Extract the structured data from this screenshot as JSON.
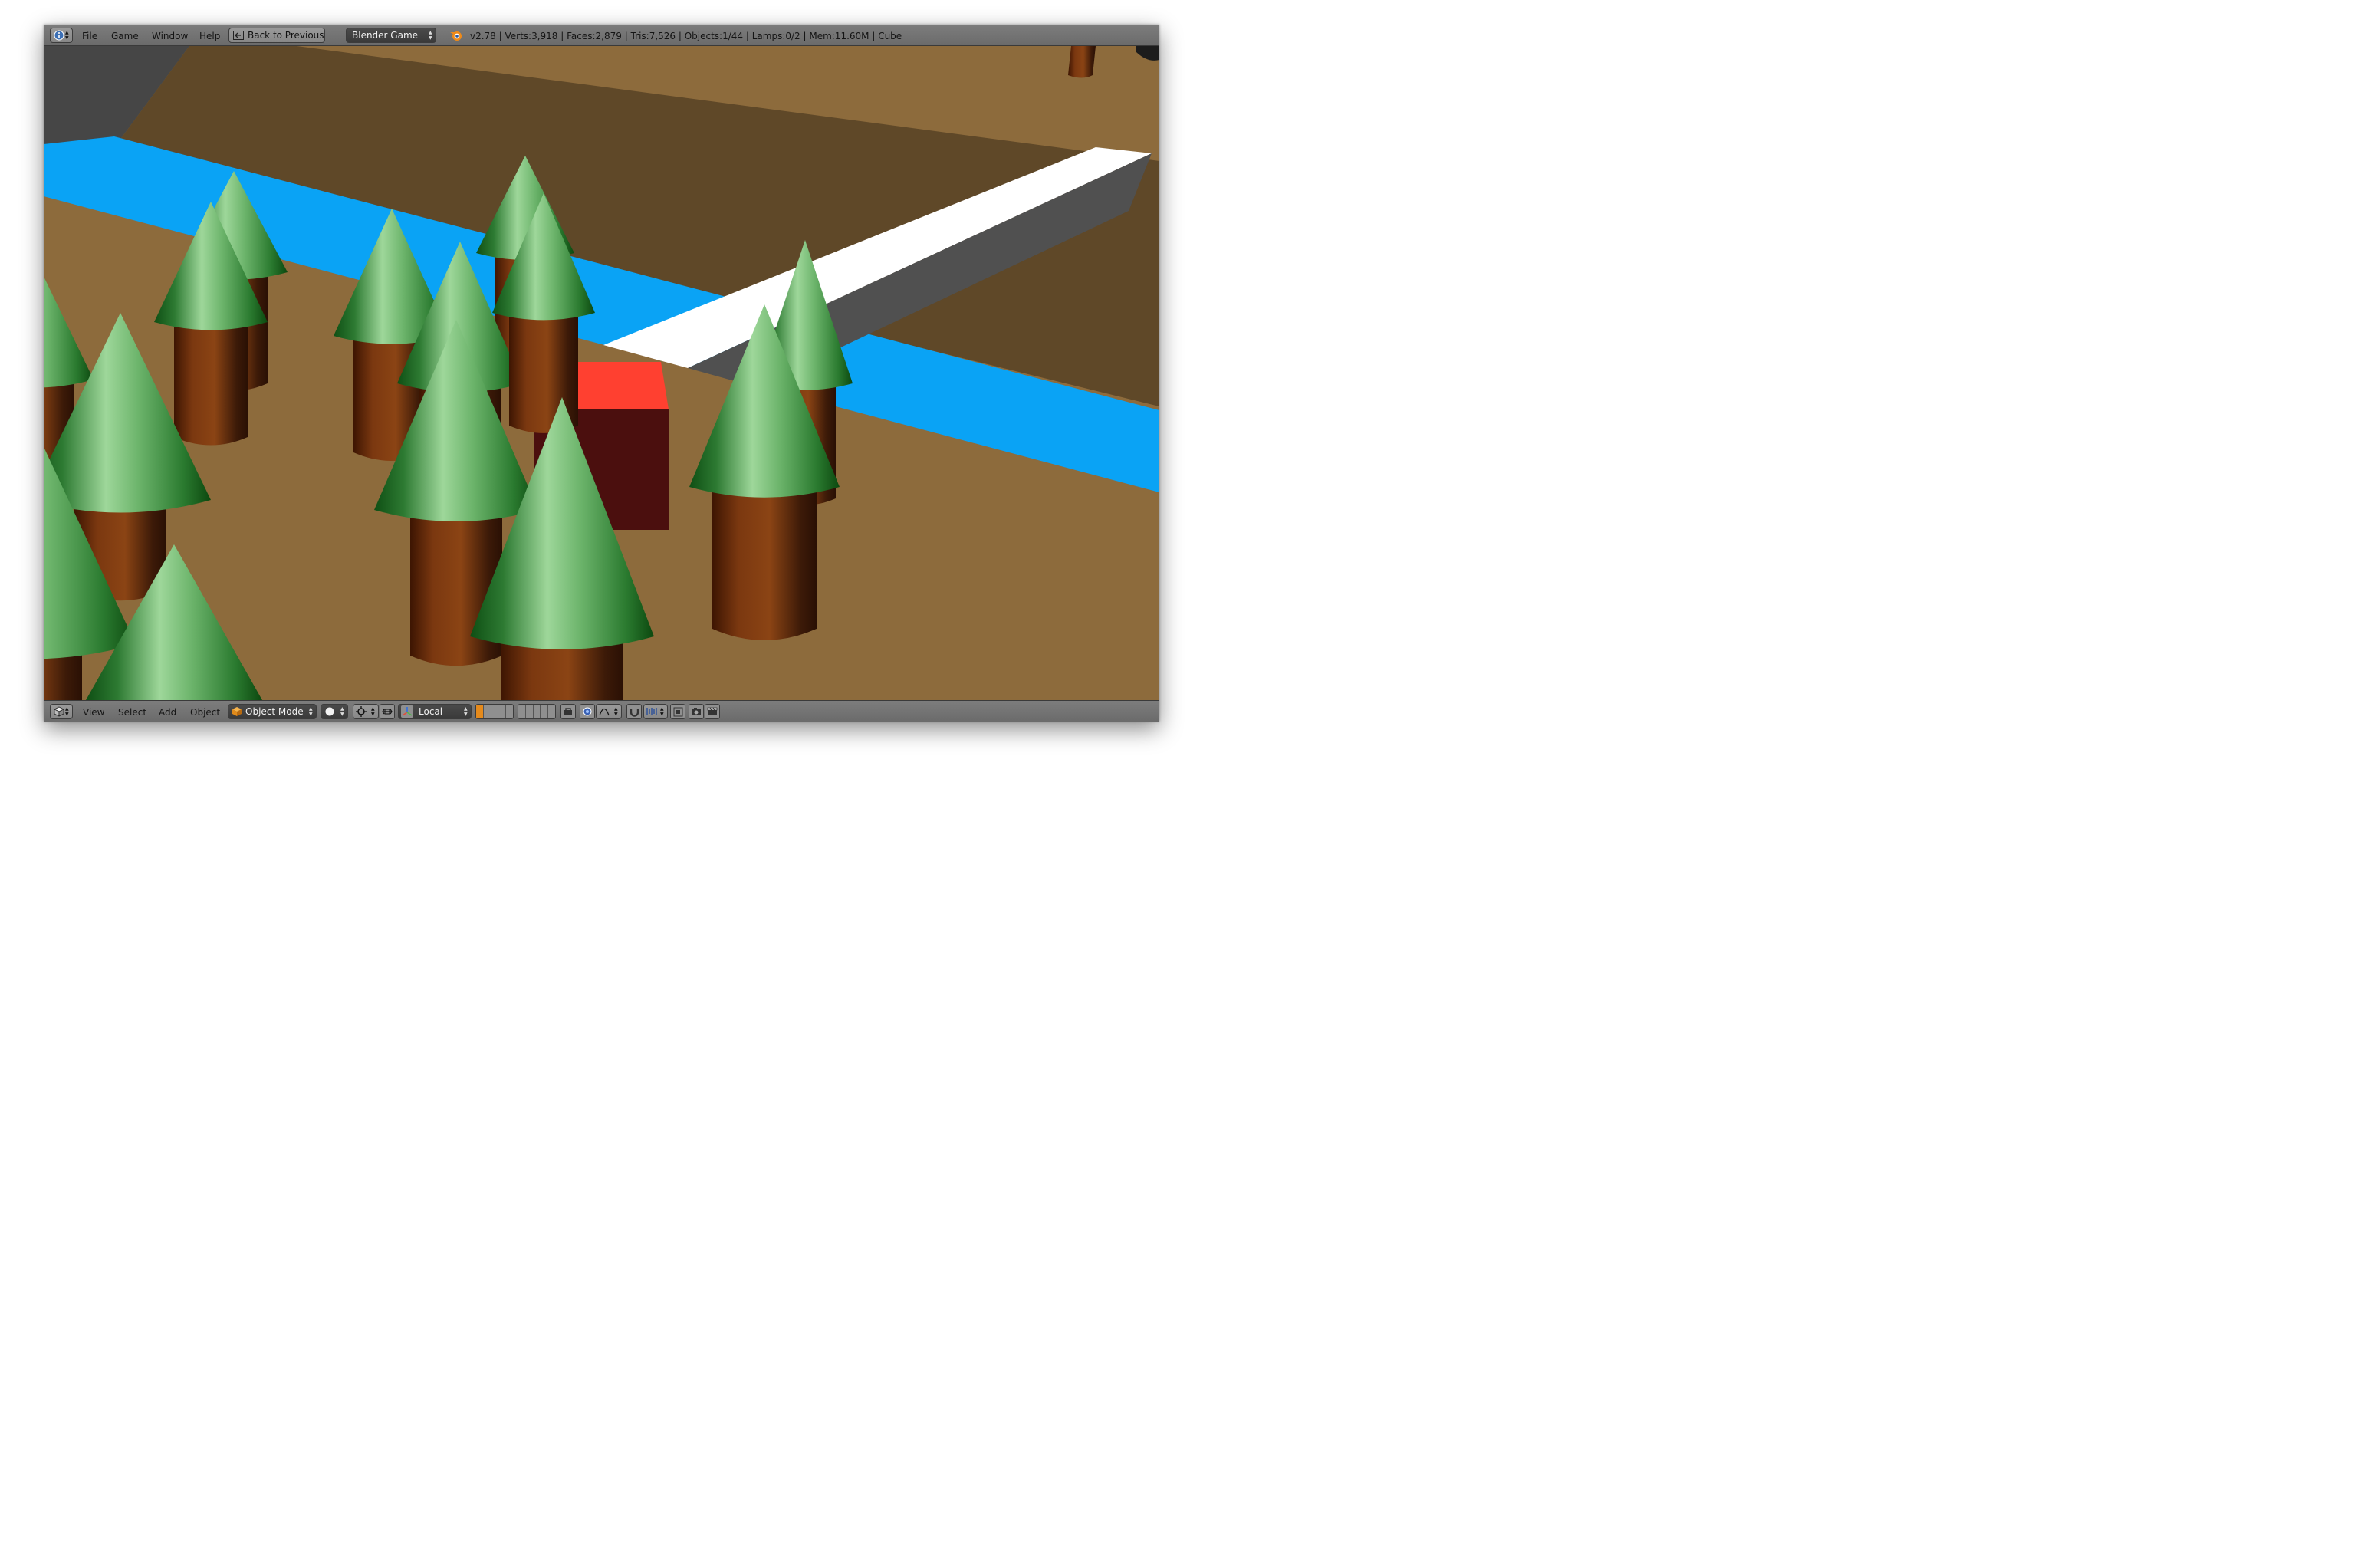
{
  "window": {
    "menu": [
      "File",
      "Game",
      "Window",
      "Help"
    ],
    "back_button_label": "Back to Previous",
    "engine_select": "Blender Game",
    "stats": "v2.78 | Verts:3,918 | Faces:2,879 | Tris:7,526 | Objects:1/44 | Lamps:0/2 | Mem:11.60M | Cube"
  },
  "viewport_header": {
    "menu": [
      "View",
      "Select",
      "Add",
      "Object"
    ],
    "mode_select": "Object Mode",
    "orientation_select": "Local"
  },
  "icons": {
    "info_editor": "info-icon",
    "blender_logo": "blender-logo-icon",
    "editor_type_3d": "cube-view-icon",
    "object_mode": "object-cube-icon",
    "shading": "solid-sphere-icon",
    "pivot": "pivot-point-icon",
    "manipulator": "manipulator-icon",
    "orientation": "transform-axes-icon",
    "proportional": "proportional-edit-icon",
    "snap": "magnet-icon",
    "render": "camera-render-icon"
  },
  "colors": {
    "ground": "#8d6b3c",
    "ground_far": "#5f4828",
    "water": "#0aa3f5",
    "cube_top": "#ff4030",
    "cube_side": "#4b0f0e",
    "path": "#ffffff",
    "foliage": "#3f9a48",
    "trunk": "#6b2e0e"
  }
}
